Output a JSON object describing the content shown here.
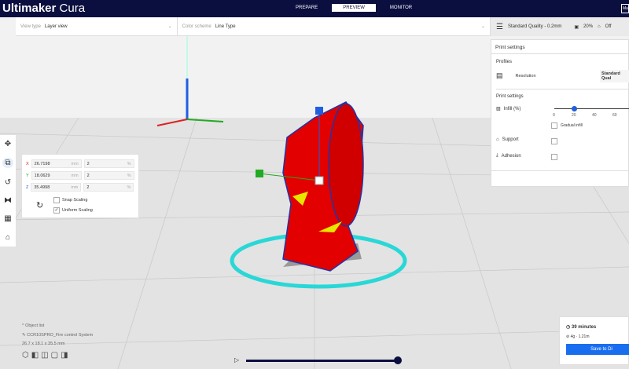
{
  "app": {
    "title_bold": "Ultimaker",
    "title_light": " Cura",
    "marketplace_label": "Ma"
  },
  "stages": [
    {
      "label": "PREPARE"
    },
    {
      "label": "PREVIEW"
    },
    {
      "label": "MONITOR"
    }
  ],
  "view_bar": {
    "view_type_label": "View type",
    "view_type_value": "Layer view",
    "color_scheme_label": "Color scheme",
    "color_scheme_value": "Line Type"
  },
  "print_bar": {
    "profile": "Standard Quality - 0.2mm",
    "infill": "20%",
    "support": "Off"
  },
  "print_settings": {
    "title": "Print settings",
    "profiles_label": "Profiles",
    "resolution_label": "Resolution",
    "resolution_value": "Standard Qual",
    "section_label": "Print settings",
    "infill_label": "Infill (%)",
    "infill_value": 20,
    "infill_ticks": [
      "0",
      "20",
      "40",
      "60"
    ],
    "gradual_infill_label": "Gradual infill",
    "support_label": "Support",
    "adhesion_label": "Adhesion"
  },
  "scale": {
    "x": "26.7198",
    "y": "18.0629",
    "z": "35.4998",
    "unit": "mm",
    "px": "2",
    "py": "2",
    "pz": "2",
    "pct": "%",
    "snap_label": "Snap Scaling",
    "uniform_label": "Uniform Scaling",
    "axis_x": "X",
    "axis_y": "Y",
    "axis_z": "Z"
  },
  "object_list": {
    "header": "Object list",
    "object_name": "CCR10SPRO_Fire control System",
    "dimensions": "26.7 x 18.1 x 35.5 mm"
  },
  "job": {
    "time": "39 minutes",
    "material": "4g · 1.21m",
    "save_label": "Save to Di"
  },
  "layer_slider": {
    "value": 1.0
  }
}
